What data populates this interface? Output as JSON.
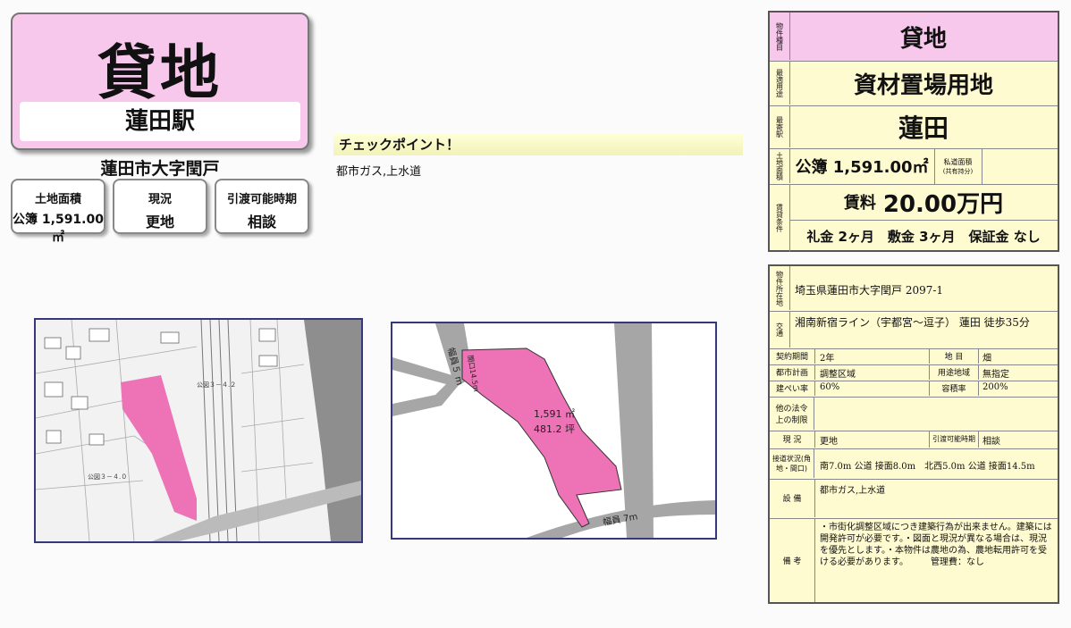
{
  "header": {
    "type": "貸地",
    "station": "蓮田駅",
    "address": "蓮田市大字閏戸"
  },
  "info_boxes": [
    {
      "label": "土地面積",
      "value": "公簿 1,591.00㎡"
    },
    {
      "label": "現況",
      "value": "更地"
    },
    {
      "label": "引渡可能時期",
      "value": "相談"
    }
  ],
  "checkpoint": {
    "title": "チェックポイント！",
    "body": "都市ガス,上水道"
  },
  "map": {
    "labels": [
      "公図３－４.２",
      "公図３－４.０"
    ]
  },
  "survey": {
    "frontage": "間口14.5m",
    "road_nw": "幅員５ m",
    "road_s": "幅員 7m",
    "area_m2": "1,591 ㎡",
    "area_tsubo": "481.2 坪"
  },
  "summary": {
    "type_label": "物件種目",
    "type": "貸地",
    "use_label": "最適用途",
    "use": "資材置場用地",
    "station_label": "最寄駅",
    "station": "蓮田",
    "area_label": "土地面積",
    "area": "公簿 1,591.00㎡",
    "private_road_label": "私道面積",
    "private_road_sub": "(共有持分)",
    "terms_label": "賃貸条件",
    "rent_prefix": "賃料",
    "rent": "20.00万円",
    "deposit": "礼金 2ヶ月　敷金 3ヶ月　保証金 なし"
  },
  "details": {
    "location_label": "物件所在地",
    "location": "埼玉県蓮田市大字閏戸 2097-1",
    "transport_label": "交通",
    "transport": "湘南新宿ライン（宇都宮～逗子） 蓮田 徒歩35分",
    "contract_label": "契約期間",
    "contract": "2年",
    "landcat_label": "地 目",
    "landcat": "畑",
    "plan_label": "都市計画",
    "plan": "調整区域",
    "zone_label": "用途地域",
    "zone": "無指定",
    "bcr_label": "建ぺい率",
    "bcr": "60%",
    "far_label": "容積率",
    "far": "200%",
    "legal_label": "他の法令上の制限",
    "legal": "",
    "status_label": "現 況",
    "status": "更地",
    "handover_label": "引渡可能時期",
    "handover": "相談",
    "road_label": "接道状況(角地・間口)",
    "road": "南7.0m 公道 接面8.0m　北西5.0m 公道 接面14.5m",
    "facility_label": "設 備",
    "facility": "都市ガス,上水道",
    "remarks_label": "備 考",
    "remarks": "・市街化調整区域につき建築行為が出来ません。建築には開発許可が必要です。・図面と現況が異なる場合は、現況を優先とします。・本物件は農地の為、農地転用許可を受ける必要があります。　　　管理費：なし"
  }
}
